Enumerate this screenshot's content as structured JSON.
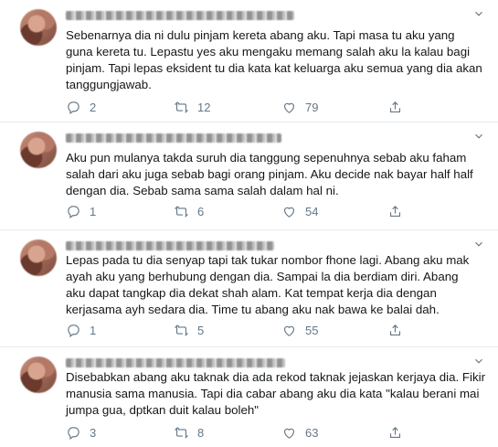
{
  "tweets": [
    {
      "text": "Sebenarnya dia ni dulu pinjam kereta abang aku. Tapi masa tu aku yang\nguna kereta tu. Lepastu yes aku mengaku memang salah aku la kalau bagi\npinjam. Tapi lepas eksident tu dia kata kat keluarga aku semua yang dia akan\ntanggungjawab.",
      "reply_count": "2",
      "retweet_count": "12",
      "like_count": "79"
    },
    {
      "text": "Aku pun mulanya takda suruh dia tanggung sepenuhnya sebab aku faham\nsalah dari aku juga sebab bagi orang pinjam. Aku decide nak bayar half half\ndengan dia. Sebab sama sama salah dalam hal ni.",
      "reply_count": "1",
      "retweet_count": "6",
      "like_count": "54"
    },
    {
      "text": "Lepas pada tu dia senyap tapi tak tukar nombor fhone lagi. Abang aku mak\nayah aku yang berhubung dengan dia. Sampai la dia berdiam diri. Abang\naku dapat tangkap dia dekat shah alam. Kat tempat kerja dia dengan\nkerjasama ayh sedara dia. Time tu abang aku nak bawa ke balai dah.",
      "reply_count": "1",
      "retweet_count": "5",
      "like_count": "55"
    },
    {
      "text": "Disebabkan abang aku taknak dia ada rekod taknak jejaskan kerjaya dia. Fikir\nmanusia sama manusia. Tapi dia cabar abang aku dia kata \"kalau berani mai\njumpa gua, dptkan duit kalau boleh\"",
      "reply_count": "3",
      "retweet_count": "8",
      "like_count": "63"
    }
  ],
  "icons": {
    "reply": "reply-icon",
    "retweet": "retweet-icon",
    "like": "heart-icon",
    "share": "share-icon",
    "more": "chevron-down-icon"
  },
  "colors": {
    "text": "#14171a",
    "secondary": "#657786",
    "divider": "#e6ecf0"
  }
}
